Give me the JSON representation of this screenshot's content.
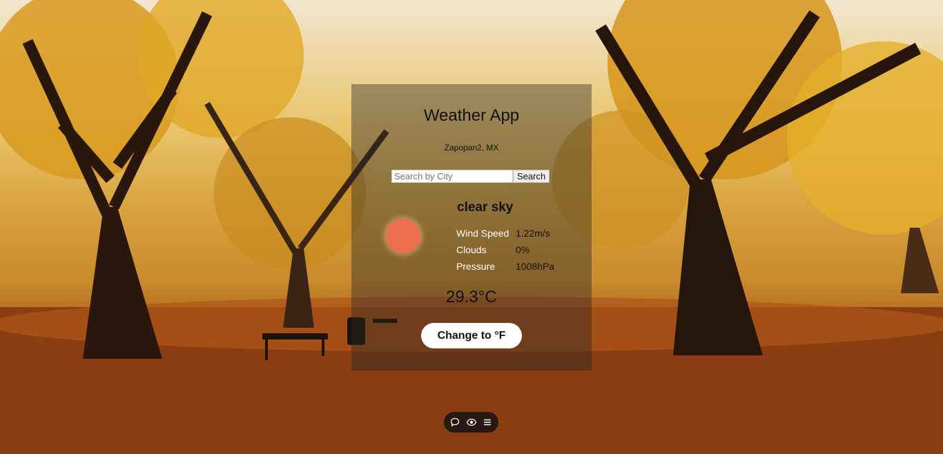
{
  "app": {
    "title": "Weather App",
    "location": "Zapopan2, MX"
  },
  "search": {
    "placeholder": "Search by City",
    "button_label": "Search"
  },
  "weather": {
    "icon": "sun-icon",
    "icon_color": "#ec6e4c",
    "description": "clear sky",
    "stats": [
      {
        "label": "Wind Speed",
        "value": "1.22m/s"
      },
      {
        "label": "Clouds",
        "value": "0%"
      },
      {
        "label": "Pressure",
        "value": "1008hPa"
      }
    ],
    "temperature": "29.3°C"
  },
  "controls": {
    "toggle_label": "Change to °F"
  },
  "toolbar": {
    "icons": [
      "chat-icon",
      "eye-icon",
      "menu-icon"
    ]
  }
}
